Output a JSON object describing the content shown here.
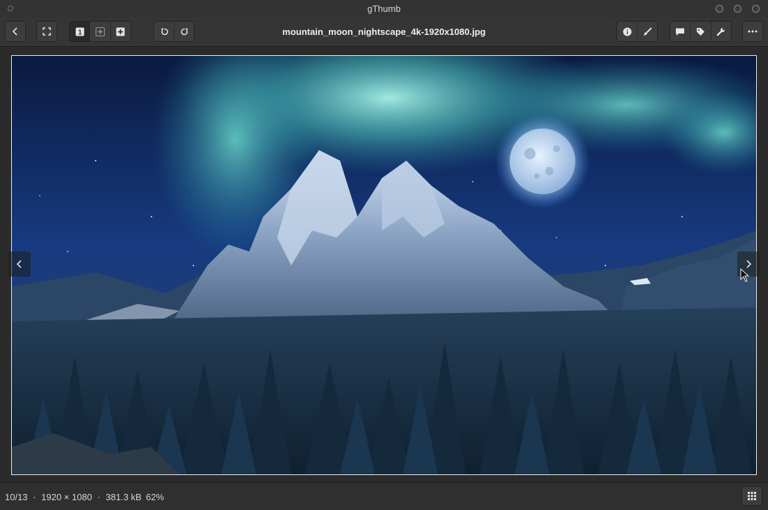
{
  "window": {
    "title": "gThumb"
  },
  "toolbar": {
    "filename": "mountain_moon_nightscape_4k-1920x1080.jpg",
    "icons": {
      "back": "back-arrow-icon",
      "fullscreen": "fullscreen-icon",
      "zoom_actual": "zoom-1-1-icon",
      "zoom_fit": "zoom-fit-icon",
      "zoom_fill": "zoom-fill-icon",
      "rotate_left": "rotate-left-icon",
      "rotate_right": "rotate-right-icon",
      "properties": "info-icon",
      "edit": "brush-icon",
      "comment": "comment-icon",
      "tags": "tag-icon",
      "tools": "wrench-icon",
      "menu": "more-icon"
    },
    "zoom_actual_glyph": "1"
  },
  "viewer": {
    "image_description_icon": "photo",
    "prev_icon": "chevron-left-icon",
    "next_icon": "chevron-right-icon"
  },
  "status": {
    "position": "10/13",
    "separator": "·",
    "dimensions": "1920 × 1080",
    "size": "381.3 kB",
    "zoom": "62%"
  },
  "colors": {
    "chrome": "#353535",
    "background": "#2b2b2b",
    "aurora": "#7ee3d6",
    "sky": "#1b3f86"
  }
}
